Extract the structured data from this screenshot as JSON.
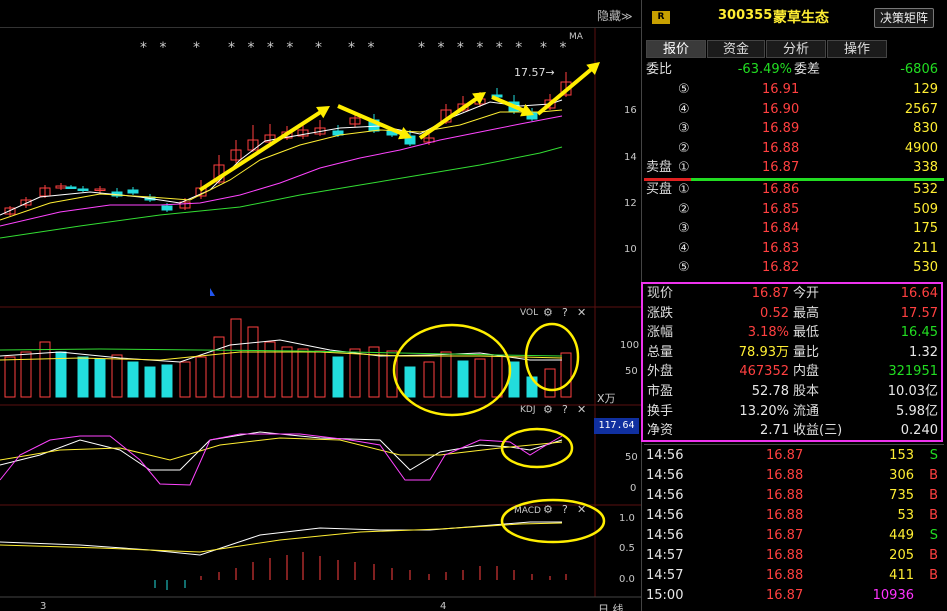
{
  "header": {
    "hide_label": "隐藏",
    "hide_arrow": "≫",
    "stock_code": "300355",
    "stock_name": "蒙草生态",
    "r_badge": "R",
    "decision_button": "决策矩阵"
  },
  "tabs": [
    {
      "label": "报价"
    },
    {
      "label": "资金"
    },
    {
      "label": "分析"
    },
    {
      "label": "操作"
    }
  ],
  "chart": {
    "ma_label": "MA",
    "high_marker": "17.57→",
    "price_axis": [
      "16",
      "14",
      "12",
      "10"
    ],
    "vol_label": "VOL",
    "vol_axis": [
      "100",
      "50"
    ],
    "vol_unit": "X万",
    "kdj_label": "KDJ",
    "kdj_axis": [
      "50",
      "0"
    ],
    "kdj_current": "117.64",
    "macd_label": "MACD",
    "macd_axis": [
      "1.0",
      "0.5",
      "0.0"
    ],
    "period_label": "日 线",
    "x_ticks": [
      "3",
      "4"
    ],
    "star_groups": [
      "* *",
      "*",
      "* * * *",
      "*",
      "* *",
      "* * * * * *",
      "* *"
    ],
    "help_icon": "?",
    "close_icon": "✕",
    "settings_icon": "⚙"
  },
  "order_book": {
    "ratio_label": "委比",
    "ratio_value": "-63.49%",
    "diff_label": "委差",
    "diff_value": "-6806",
    "sell": [
      {
        "level": "⑤",
        "price": "16.91",
        "volume": "129"
      },
      {
        "level": "④",
        "price": "16.90",
        "volume": "2567"
      },
      {
        "level": "③",
        "price": "16.89",
        "volume": "830"
      },
      {
        "level": "②",
        "price": "16.88",
        "volume": "4900"
      },
      {
        "level": "①",
        "price": "16.87",
        "volume": "338"
      }
    ],
    "sell_label": "卖盘",
    "buy_label": "买盘",
    "buy": [
      {
        "level": "①",
        "price": "16.86",
        "volume": "532"
      },
      {
        "level": "②",
        "price": "16.85",
        "volume": "509"
      },
      {
        "level": "③",
        "price": "16.84",
        "volume": "175"
      },
      {
        "level": "④",
        "price": "16.83",
        "volume": "211"
      },
      {
        "level": "⑤",
        "price": "16.82",
        "volume": "530"
      }
    ]
  },
  "quote": {
    "rows": [
      {
        "l1": "现价",
        "v1": "16.87",
        "l2": "今开",
        "v2": "16.64"
      },
      {
        "l1": "涨跌",
        "v1": "0.52",
        "l2": "最高",
        "v2": "17.57"
      },
      {
        "l1": "涨幅",
        "v1": "3.18%",
        "l2": "最低",
        "v2": "16.45"
      },
      {
        "l1": "总量",
        "v1": "78.93万",
        "l2": "量比",
        "v2": "1.32"
      },
      {
        "l1": "外盘",
        "v1": "467352",
        "l2": "内盘",
        "v2": "321951"
      },
      {
        "l1": "市盈",
        "v1": "52.78",
        "l2": "股本",
        "v2": "10.03亿"
      },
      {
        "l1": "换手",
        "v1": "13.20%",
        "l2": "流通",
        "v2": "5.98亿"
      },
      {
        "l1": "净资",
        "v1": "2.71",
        "l2": "收益(三)",
        "v2": "0.240"
      }
    ]
  },
  "trades": [
    {
      "time": "14:56",
      "price": "16.87",
      "volume": "153",
      "side": "S"
    },
    {
      "time": "14:56",
      "price": "16.88",
      "volume": "306",
      "side": "B"
    },
    {
      "time": "14:56",
      "price": "16.88",
      "volume": "735",
      "side": "B"
    },
    {
      "time": "14:56",
      "price": "16.88",
      "volume": "53",
      "side": "B"
    },
    {
      "time": "14:56",
      "price": "16.87",
      "volume": "449",
      "side": "S"
    },
    {
      "time": "14:57",
      "price": "16.88",
      "volume": "205",
      "side": "B"
    },
    {
      "time": "14:57",
      "price": "16.88",
      "volume": "411",
      "side": "B"
    },
    {
      "time": "15:00",
      "price": "16.87",
      "volume": "10936",
      "side": ""
    }
  ],
  "colors": {
    "up": "#ff4040",
    "down": "#22dddd",
    "ma5": "#ffffff",
    "ma10": "#ffee33",
    "ma20": "#ff44ff",
    "ma60": "#33dd33",
    "annotation": "#ffee00",
    "highlight_box": "#ee33ee"
  }
}
